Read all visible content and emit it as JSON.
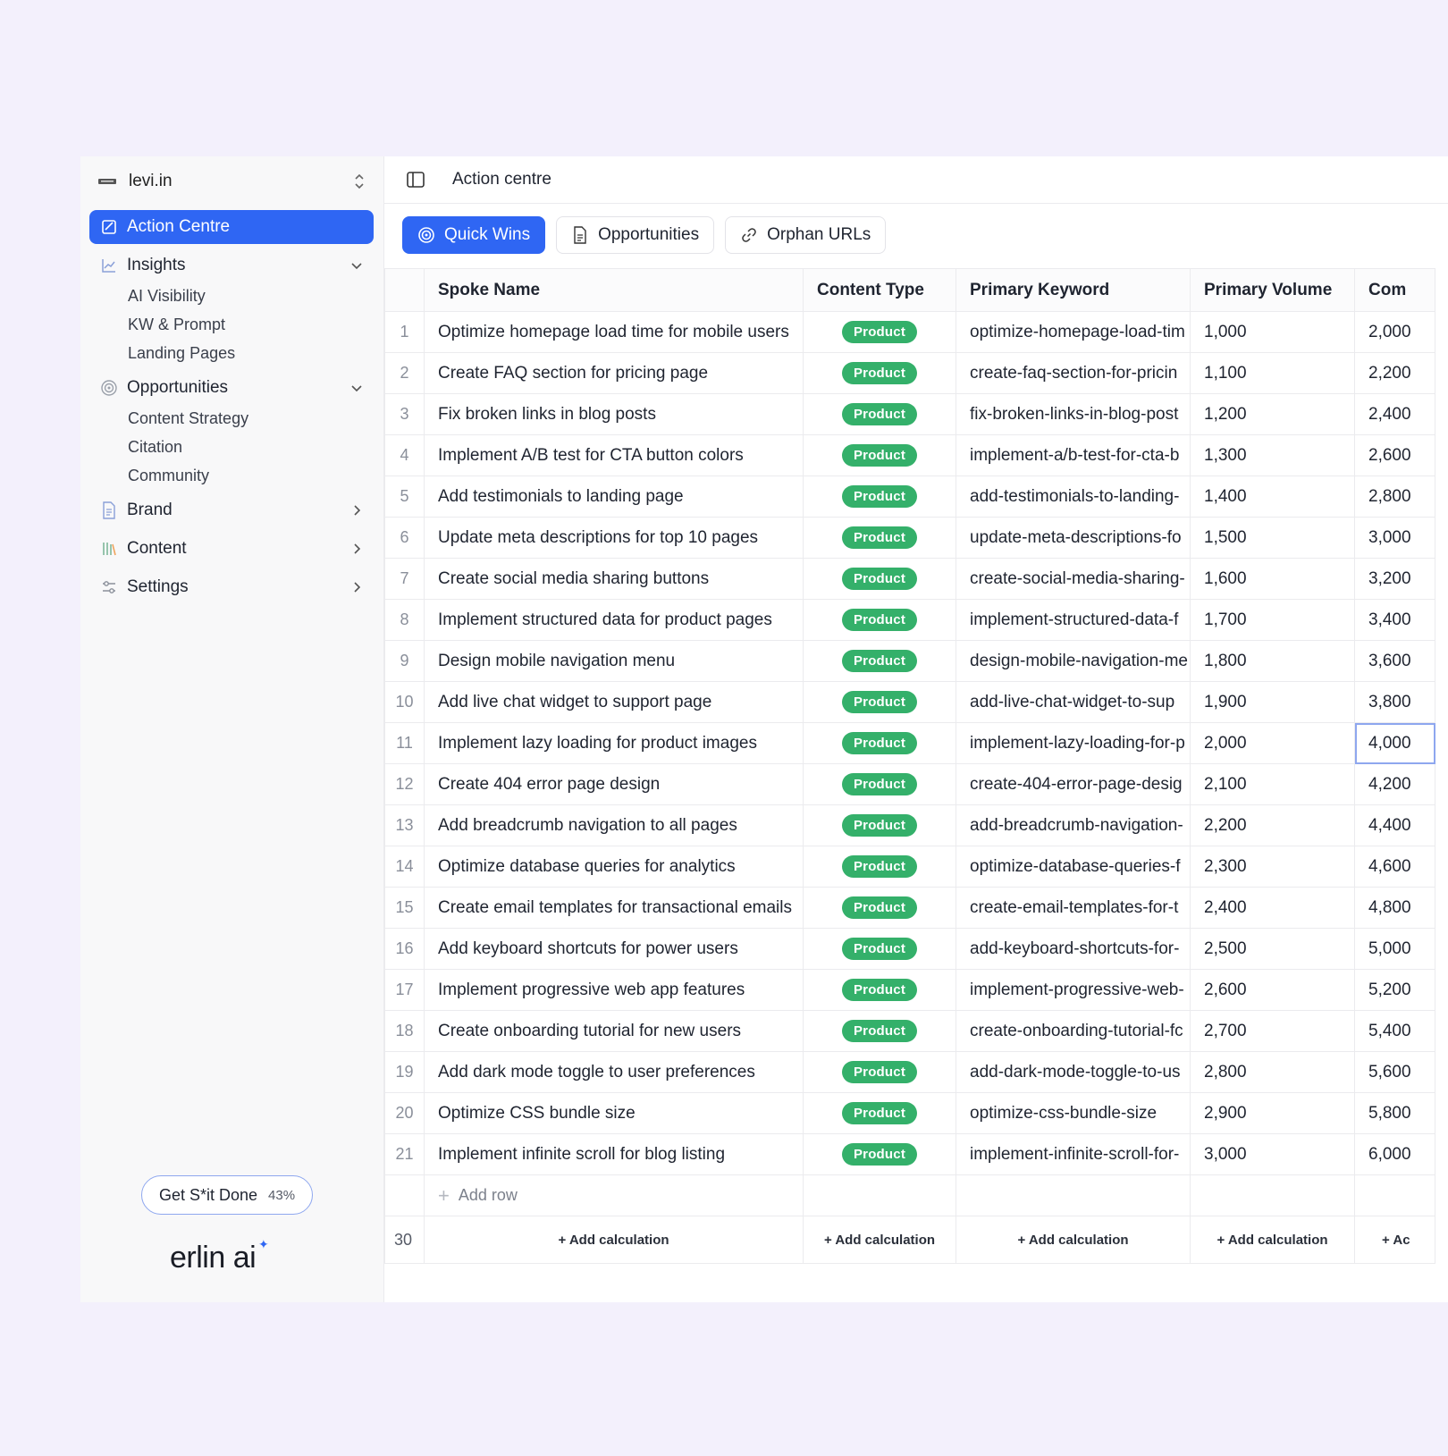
{
  "workspace": {
    "name": "levi.in"
  },
  "sidebar": {
    "active_item": "Action Centre",
    "groups": [
      {
        "label": "Insights",
        "items": [
          "AI Visibility",
          "KW & Prompt",
          "Landing Pages"
        ]
      },
      {
        "label": "Opportunities",
        "items": [
          "Content Strategy",
          "Citation",
          "Community"
        ]
      },
      {
        "label": "Brand"
      },
      {
        "label": "Content"
      },
      {
        "label": "Settings"
      }
    ],
    "cta": {
      "label": "Get S*it Done",
      "progress": "43%"
    },
    "logo": "erlin ai"
  },
  "header": {
    "title": "Action centre"
  },
  "tabs": [
    "Quick Wins",
    "Opportunities",
    "Orphan URLs"
  ],
  "colors": {
    "accent": "#2f66f3",
    "pill": "#34b06a"
  },
  "table": {
    "columns": [
      "Spoke Name",
      "Content Type",
      "Primary Keyword",
      "Primary Volume",
      "Com"
    ],
    "rows": [
      [
        "1",
        "Optimize homepage load time for mobile users",
        "Product",
        "optimize-homepage-load-tim",
        "1,000",
        "2,000"
      ],
      [
        "2",
        "Create FAQ section for pricing page",
        "Product",
        "create-faq-section-for-pricin",
        "1,100",
        "2,200"
      ],
      [
        "3",
        "Fix broken links in blog posts",
        "Product",
        "fix-broken-links-in-blog-post",
        "1,200",
        "2,400"
      ],
      [
        "4",
        "Implement A/B test for CTA button colors",
        "Product",
        "implement-a/b-test-for-cta-b",
        "1,300",
        "2,600"
      ],
      [
        "5",
        "Add testimonials to landing page",
        "Product",
        "add-testimonials-to-landing-",
        "1,400",
        "2,800"
      ],
      [
        "6",
        "Update meta descriptions for top 10 pages",
        "Product",
        "update-meta-descriptions-fo",
        "1,500",
        "3,000"
      ],
      [
        "7",
        "Create social media sharing buttons",
        "Product",
        "create-social-media-sharing-",
        "1,600",
        "3,200"
      ],
      [
        "8",
        "Implement structured data for product pages",
        "Product",
        "implement-structured-data-f",
        "1,700",
        "3,400"
      ],
      [
        "9",
        "Design mobile navigation menu",
        "Product",
        "design-mobile-navigation-me",
        "1,800",
        "3,600"
      ],
      [
        "10",
        "Add live chat widget to support page",
        "Product",
        "add-live-chat-widget-to-sup",
        "1,900",
        "3,800"
      ],
      [
        "11",
        "Implement lazy loading for product images",
        "Product",
        "implement-lazy-loading-for-p",
        "2,000",
        "4,000"
      ],
      [
        "12",
        "Create 404 error page design",
        "Product",
        "create-404-error-page-desig",
        "2,100",
        "4,200"
      ],
      [
        "13",
        "Add breadcrumb navigation to all pages",
        "Product",
        "add-breadcrumb-navigation-",
        "2,200",
        "4,400"
      ],
      [
        "14",
        "Optimize database queries for analytics",
        "Product",
        "optimize-database-queries-f",
        "2,300",
        "4,600"
      ],
      [
        "15",
        "Create email templates for transactional emails",
        "Product",
        "create-email-templates-for-t",
        "2,400",
        "4,800"
      ],
      [
        "16",
        "Add keyboard shortcuts for power users",
        "Product",
        "add-keyboard-shortcuts-for-",
        "2,500",
        "5,000"
      ],
      [
        "17",
        "Implement progressive web app features",
        "Product",
        "implement-progressive-web-",
        "2,600",
        "5,200"
      ],
      [
        "18",
        "Create onboarding tutorial for new users",
        "Product",
        "create-onboarding-tutorial-fc",
        "2,700",
        "5,400"
      ],
      [
        "19",
        "Add dark mode toggle to user preferences",
        "Product",
        "add-dark-mode-toggle-to-us",
        "2,800",
        "5,600"
      ],
      [
        "20",
        "Optimize CSS bundle size",
        "Product",
        "optimize-css-bundle-size",
        "2,900",
        "5,800"
      ],
      [
        "21",
        "Implement infinite scroll for blog listing",
        "Product",
        "implement-infinite-scroll-for-",
        "3,000",
        "6,000"
      ]
    ],
    "add_row_label": "Add row",
    "footer": {
      "count": "30",
      "calc_label": "+ Add calculation",
      "calc_label_clipped": "+ Ac"
    }
  }
}
